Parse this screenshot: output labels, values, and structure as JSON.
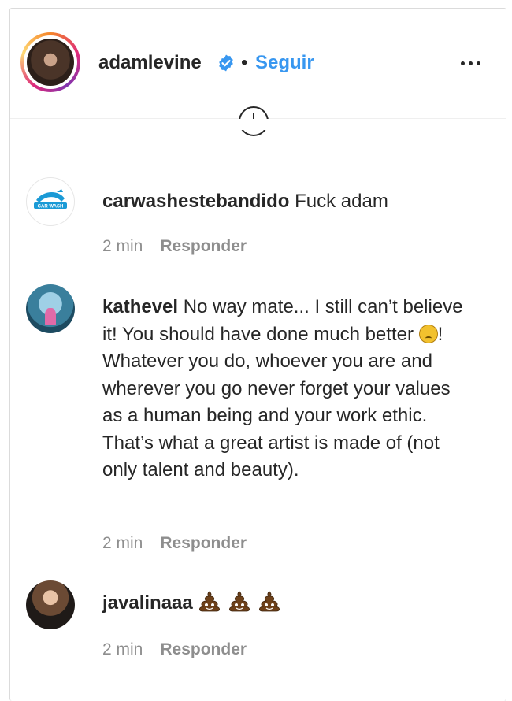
{
  "post_header": {
    "username": "adamlevine",
    "separator": "•",
    "follow_label": "Seguir"
  },
  "comments": [
    {
      "username": "carwashestebandido",
      "text": "Fuck adam",
      "avatar_text": "CAR WASH",
      "time": "2 min",
      "reply_label": "Responder"
    },
    {
      "username": "kathevel",
      "text_before_emoji": "No way mate... I still can’t believe it! You should have done much better ",
      "emoji": "disappointed-face",
      "text_after_emoji": "! Whatever you do, whoever you are and wherever you go never forget your values as a human being and your work ethic. That’s what a great artist is made of (not only talent and beauty).",
      "time": "2 min",
      "reply_label": "Responder"
    },
    {
      "username": "javalinaaa",
      "emoji": "pile-of-poo",
      "emoji_count": 3,
      "time": "2 min",
      "reply_label": "Responder"
    }
  ],
  "colors": {
    "link_blue": "#3897f0",
    "text": "#262626",
    "meta_gray": "#8e8e8e",
    "border": "#dbdbdb"
  }
}
